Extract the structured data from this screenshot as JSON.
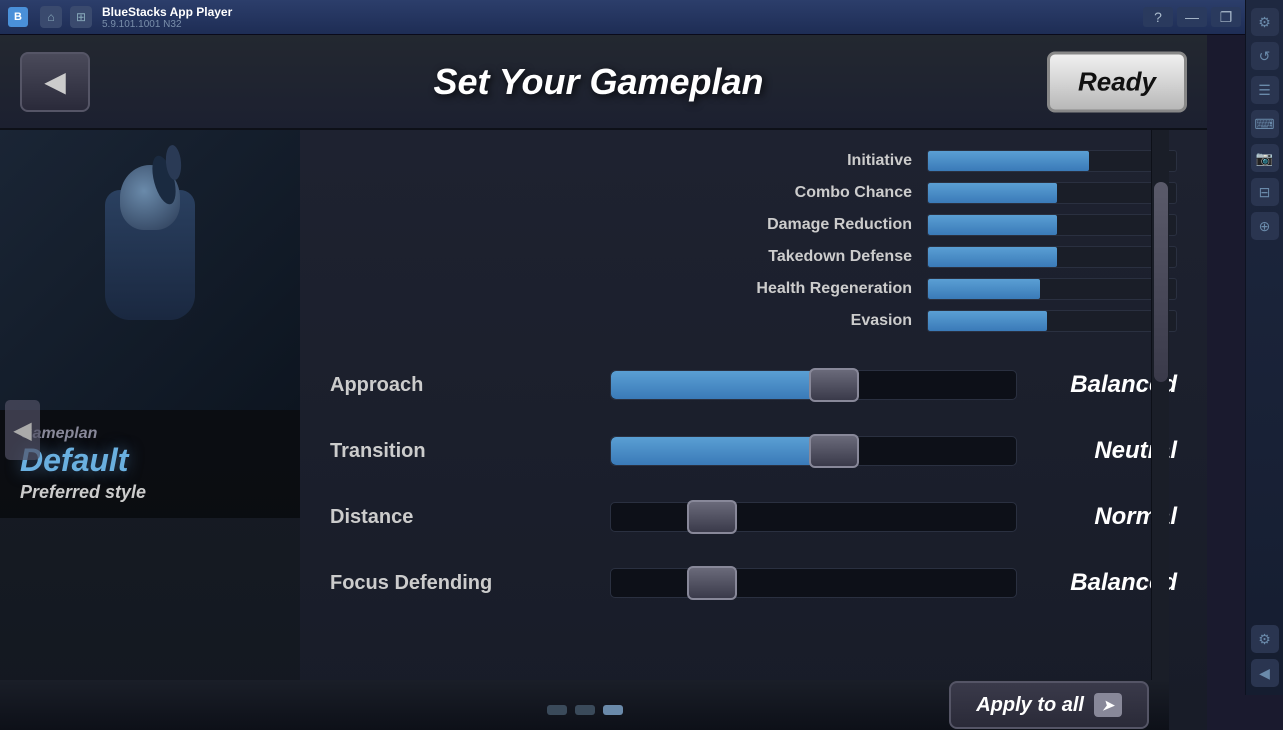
{
  "titlebar": {
    "app_name": "BlueStacks App Player",
    "version": "5.9.101.1001  N32",
    "nav_home": "⌂",
    "nav_multi": "⊞",
    "btn_help": "?",
    "btn_minimize": "—",
    "btn_restore": "❐",
    "btn_close": "✕"
  },
  "header": {
    "back_label": "◀",
    "title": "Set Your Gameplan",
    "ready_label": "Ready"
  },
  "fighter": {
    "gameplan_label": "Gameplan",
    "gameplan_name": "Default",
    "style_label": "Preferred style"
  },
  "stats": {
    "bars": [
      {
        "label": "Initiative",
        "fill_pct": 65
      },
      {
        "label": "Combo Chance",
        "fill_pct": 52
      },
      {
        "label": "Damage Reduction",
        "fill_pct": 52
      },
      {
        "label": "Takedown Defense",
        "fill_pct": 52
      },
      {
        "label": "Health Regeneration",
        "fill_pct": 45
      },
      {
        "label": "Evasion",
        "fill_pct": 48
      }
    ]
  },
  "sliders": [
    {
      "label": "Approach",
      "fill_pct": 55,
      "thumb_pct": 55,
      "value": "Balanced"
    },
    {
      "label": "Transition",
      "fill_pct": 55,
      "thumb_pct": 55,
      "value": "Neutral"
    },
    {
      "label": "Distance",
      "fill_pct": 25,
      "thumb_pct": 25,
      "value": "Normal"
    },
    {
      "label": "Focus Defending",
      "fill_pct": 25,
      "thumb_pct": 25,
      "value": "Balanced"
    }
  ],
  "footer": {
    "apply_all_label": "Apply to all",
    "apply_arrow": "➤"
  },
  "sidebar_icons": [
    "⚙",
    "↺",
    "☰",
    "⌨",
    "📷",
    "⊟",
    "⊕",
    "⚙",
    "◀"
  ],
  "pagination": [
    0,
    1,
    2
  ],
  "active_dot": 2
}
